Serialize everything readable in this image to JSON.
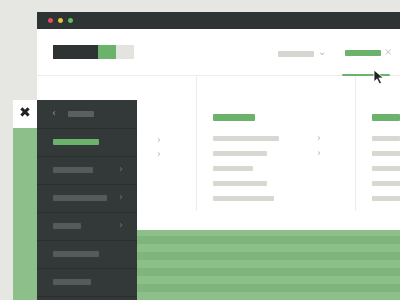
{
  "window": {
    "traffic_lights": [
      "#e84d5b",
      "#e0c63c",
      "#5fbf5b"
    ]
  },
  "header": {
    "logo_colors": [
      "#2e3333",
      "#6bb36b",
      "#e3e3df"
    ],
    "nav_dropdown_icon": "chevron-down-icon",
    "nav_active_close_icon": "close-icon",
    "cursor_icon": "mouse-pointer-icon"
  },
  "menu": {
    "close_glyph": "✖",
    "back_glyph": "‹",
    "chevron_glyph": "›",
    "dropdown_glyph": "⌄",
    "accent": "#6bb36b"
  }
}
